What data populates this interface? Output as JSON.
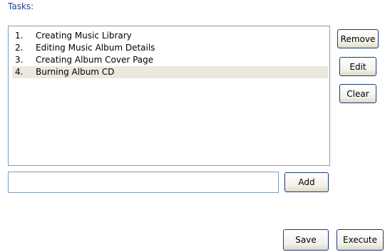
{
  "panel": {
    "title": "Tasks:"
  },
  "tasks": [
    {
      "num": "1.",
      "label": "Creating Music Library"
    },
    {
      "num": "2.",
      "label": "Editing Music Album Details"
    },
    {
      "num": "3.",
      "label": "Creating Album Cover Page"
    },
    {
      "num": "4.",
      "label": "Burning Album CD"
    }
  ],
  "selected_index": 3,
  "side_buttons": {
    "remove": "Remove",
    "edit": "Edit",
    "clear": "Clear"
  },
  "new_task": {
    "value": "",
    "add_label": "Add"
  },
  "footer": {
    "save": "Save",
    "execute": "Execute"
  },
  "colors": {
    "title": "#1f3e8f",
    "selected_row": "#ebe9de",
    "list_border": "#7f9db9",
    "button_border": "#1f3a70"
  }
}
